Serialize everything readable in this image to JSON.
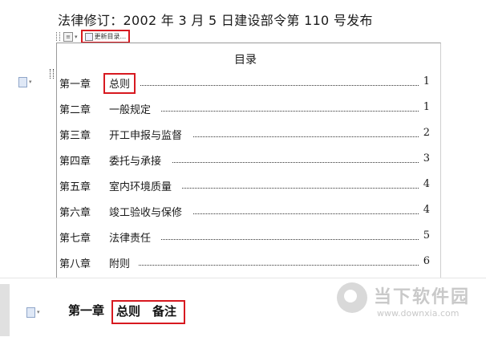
{
  "heading": "法律修订：2002 年 3 月 5 日建设部令第 110 号发布",
  "toc_toolbar": {
    "update_label": "更新目录..."
  },
  "toc": {
    "title": "目录",
    "rows": [
      {
        "chapter": "第一章",
        "name": "总则",
        "page": "1"
      },
      {
        "chapter": "第二章",
        "name": "一般规定",
        "page": "1"
      },
      {
        "chapter": "第三章",
        "name": "开工申报与监督",
        "page": "2"
      },
      {
        "chapter": "第四章",
        "name": "委托与承接",
        "page": "3"
      },
      {
        "chapter": "第五章",
        "name": "室内环境质量",
        "page": "4"
      },
      {
        "chapter": "第六章",
        "name": "竣工验收与保修",
        "page": "4"
      },
      {
        "chapter": "第七章",
        "name": "法律责任",
        "page": "5"
      },
      {
        "chapter": "第八章",
        "name": "附则",
        "page": "6"
      }
    ]
  },
  "chapter_heading": {
    "chapter": "第一章",
    "title": "总则",
    "note": "备注"
  },
  "watermark": {
    "brand": "当下软件园",
    "url": "www.downxia.com"
  },
  "colors": {
    "highlight": "#d71920",
    "paragraph_icon": "#8fa6c9"
  }
}
